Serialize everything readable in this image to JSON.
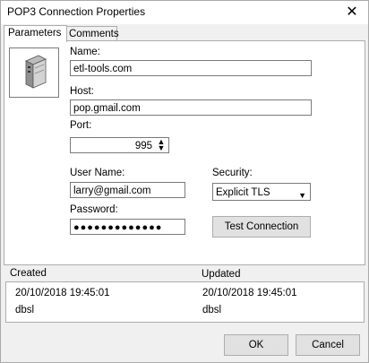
{
  "window": {
    "title": "POP3 Connection Properties"
  },
  "tabs": [
    {
      "label": "Parameters",
      "active": true
    },
    {
      "label": "Comments",
      "active": false
    }
  ],
  "icon": "server-icon",
  "form": {
    "name_label": "Name:",
    "name_value": "etl-tools.com",
    "host_label": "Host:",
    "host_value": "pop.gmail.com",
    "port_label": "Port:",
    "port_value": "995",
    "username_label": "User Name:",
    "username_value": "larry@gmail.com",
    "password_label": "Password:",
    "password_value": "●●●●●●●●●●●●●",
    "security_label": "Security:",
    "security_value": "Explicit TLS",
    "test_button": "Test Connection"
  },
  "history": {
    "created_label": "Created",
    "updated_label": "Updated",
    "created_date": "20/10/2018 19:45:01",
    "created_user": "dbsl",
    "updated_date": "20/10/2018 19:45:01",
    "updated_user": "dbsl"
  },
  "buttons": {
    "ok": "OK",
    "cancel": "Cancel"
  }
}
